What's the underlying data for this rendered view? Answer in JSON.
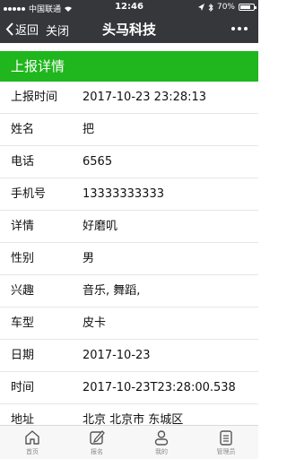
{
  "status_bar": {
    "carrier": "中国联通",
    "time": "12:46",
    "battery": "70%"
  },
  "nav": {
    "back_label": "返回",
    "close_label": "关闭",
    "title": "头马科技"
  },
  "section": {
    "title": "上报详情"
  },
  "fields": [
    {
      "label": "上报时间",
      "value": "2017-10-23 23:28:13"
    },
    {
      "label": "姓名",
      "value": "把"
    },
    {
      "label": "电话",
      "value": "6565"
    },
    {
      "label": "手机号",
      "value": "13333333333"
    },
    {
      "label": "详情",
      "value": "好磨叽"
    },
    {
      "label": "性别",
      "value": "男"
    },
    {
      "label": "兴趣",
      "value": "音乐, 舞蹈,"
    },
    {
      "label": "车型",
      "value": "皮卡"
    },
    {
      "label": "日期",
      "value": "2017-10-23"
    },
    {
      "label": "时间",
      "value": "2017-10-23T23:28:00.538"
    },
    {
      "label": "地址",
      "value": "北京 北京市 东城区"
    }
  ],
  "tabs": [
    {
      "label": "首页",
      "icon": "home-icon"
    },
    {
      "label": "报名",
      "icon": "edit-icon"
    },
    {
      "label": "我的",
      "icon": "user-icon"
    },
    {
      "label": "管理员",
      "icon": "list-icon"
    }
  ],
  "colors": {
    "accent": "#20b61d",
    "nav_bg": "#35373b"
  }
}
